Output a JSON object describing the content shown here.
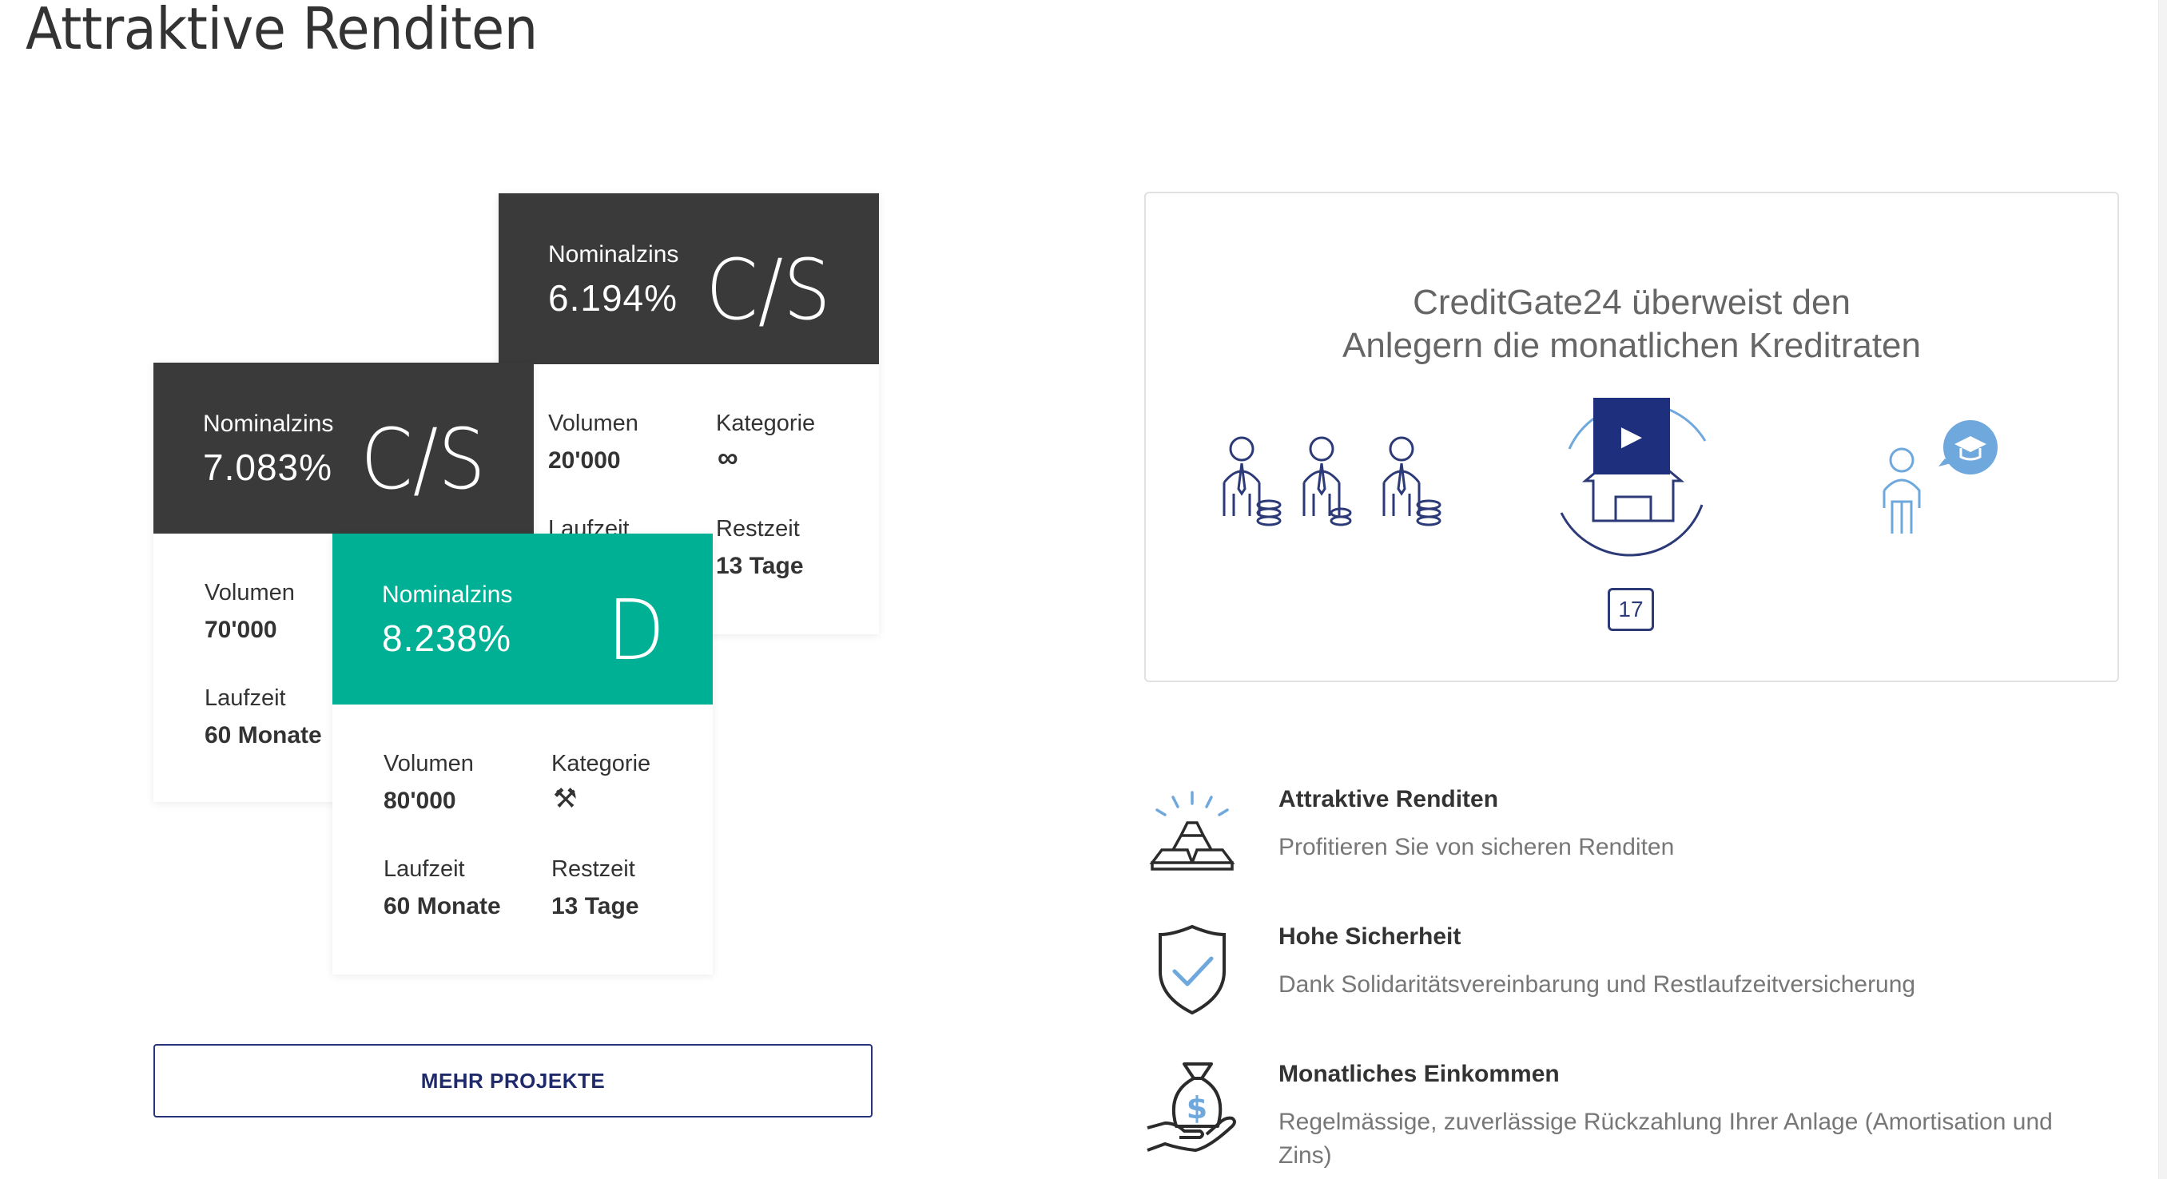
{
  "page": {
    "title": "Attraktive Renditen"
  },
  "projects": [
    {
      "nominalzins_label": "Nominalzins",
      "rate": "6.194%",
      "grade": "C/S",
      "volumen_label": "Volumen",
      "volumen": "20'000",
      "kategorie_label": "Kategorie",
      "kategorie_icon": "infinity-icon",
      "kategorie_glyph": "∞",
      "laufzeit_label": "Laufzeit",
      "restzeit_label": "Restzeit",
      "restzeit": "13 Tage"
    },
    {
      "nominalzins_label": "Nominalzins",
      "rate": "7.083%",
      "grade": "C/S",
      "volumen_label": "Volumen",
      "volumen": "70'000",
      "laufzeit_label": "Laufzeit",
      "laufzeit": "60 Monate"
    },
    {
      "nominalzins_label": "Nominalzins",
      "rate": "8.238%",
      "grade": "D",
      "volumen_label": "Volumen",
      "volumen": "80'000",
      "kategorie_label": "Kategorie",
      "kategorie_icon": "tools-icon",
      "kategorie_glyph": "⚒",
      "laufzeit_label": "Laufzeit",
      "laufzeit": "60 Monate",
      "restzeit_label": "Restzeit",
      "restzeit": "13 Tage"
    }
  ],
  "more_button": {
    "label": "MEHR PROJEKTE"
  },
  "video": {
    "caption_line1": "CreditGate24 überweist den",
    "caption_line2": "Anlegern die monatlichen Kreditraten",
    "calendar_day": "17",
    "play_icon": "play-icon"
  },
  "features": [
    {
      "icon": "gold-bars-icon",
      "title": "Attraktive Renditen",
      "description": "Profitieren Sie von sicheren Renditen"
    },
    {
      "icon": "shield-check-icon",
      "title": "Hohe Sicherheit",
      "description": "Dank Solidaritätsvereinbarung und Restlaufzeitversicherung"
    },
    {
      "icon": "money-bag-hand-icon",
      "title": "Monatliches Einkommen",
      "description": "Regelmässige, zuverlässige Rückzahlung Ihrer Anlage (Amortisation und Zins)"
    }
  ],
  "colors": {
    "dark_header": "#3a3a3a",
    "green_header": "#00b095",
    "navy": "#1e2f7d",
    "light_blue": "#6fa8dc"
  }
}
